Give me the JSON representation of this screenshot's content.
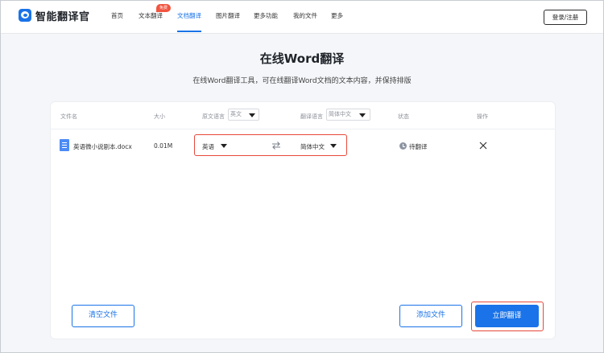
{
  "app": {
    "name": "智能翻译官"
  },
  "nav": {
    "items": [
      {
        "label": "首页"
      },
      {
        "label": "文本翻译",
        "badge": "免费"
      },
      {
        "label": "文档翻译",
        "active": true
      },
      {
        "label": "图片翻译"
      },
      {
        "label": "更多功能"
      },
      {
        "label": "我的文件"
      },
      {
        "label": "更多"
      }
    ],
    "login_label": "登录/注册"
  },
  "hero": {
    "title": "在线Word翻译",
    "subtitle": "在线Word翻译工具，可在线翻译Word文档的文本内容，并保持排版"
  },
  "table": {
    "headers": {
      "file_name": "文件名",
      "size": "大小",
      "source_lang": "原文语言",
      "target_lang": "翻译语言",
      "status": "状态",
      "action": "操作"
    },
    "source_default": "英文",
    "target_default": "简体中文",
    "rows": [
      {
        "file_name": "英语微小说剧本.docx",
        "size": "0.01M",
        "source": "英语",
        "target": "简体中文",
        "status": "待翻译"
      }
    ]
  },
  "buttons": {
    "clear": "清空文件",
    "add": "添加文件",
    "translate": "立即翻译"
  },
  "icons": {
    "logo": "app-logo-icon",
    "file": "docx-file-icon",
    "swap": "swap-arrows-icon",
    "status": "clock-icon",
    "remove": "close-icon"
  },
  "colors": {
    "accent": "#1a73e8",
    "highlight": "#e8483a",
    "badge": "#f1543f"
  }
}
